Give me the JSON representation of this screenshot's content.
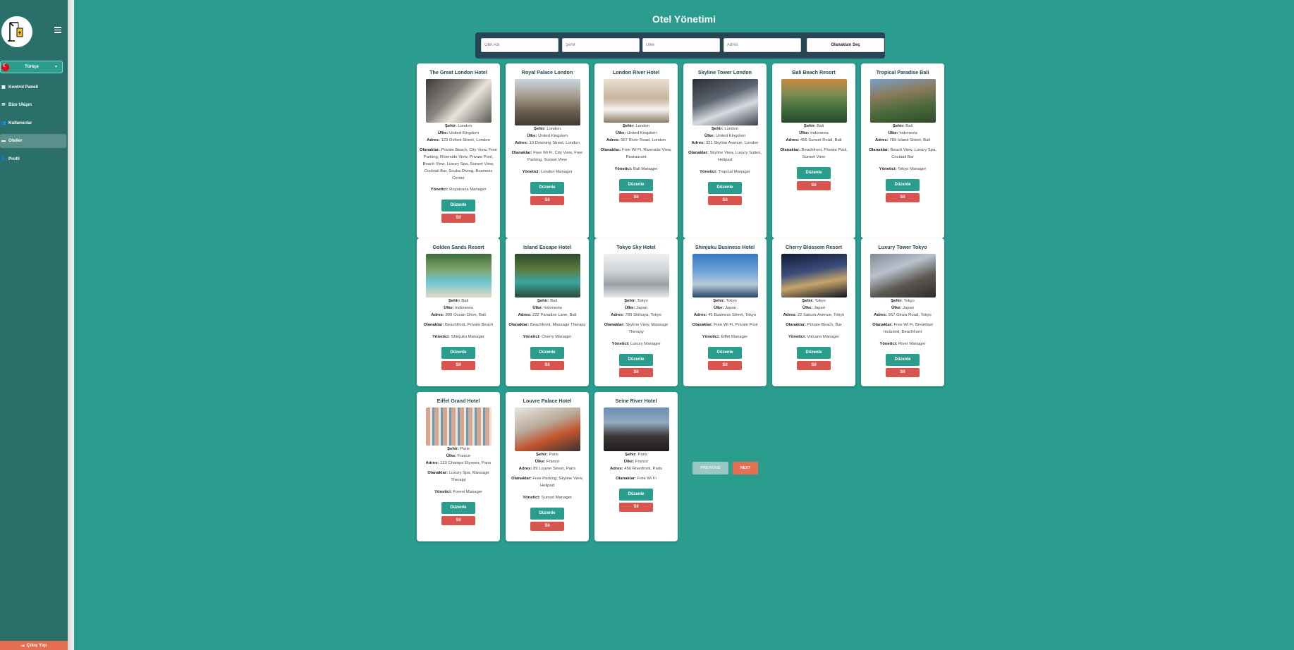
{
  "sidebar": {
    "language": "Türkçe",
    "items": [
      {
        "label": "Kontrol Paneli",
        "icon": "grid-icon",
        "active": false
      },
      {
        "label": "Bize Ulaşın",
        "icon": "envelope-icon",
        "active": false
      },
      {
        "label": "Kullanıcılar",
        "icon": "users-icon",
        "active": false
      },
      {
        "label": "Oteller",
        "icon": "bed-icon",
        "active": true
      },
      {
        "label": "Profil",
        "icon": "user-icon",
        "active": false
      }
    ],
    "logout": "Çıkış Yap"
  },
  "main": {
    "title": "Otel Yönetimi",
    "search": {
      "hotel_placeholder": "Otel Adı",
      "city_placeholder": "Şehir",
      "country_placeholder": "Ülke",
      "address_placeholder": "Adres",
      "amenities_button": "Olanakları Seç"
    },
    "labels": {
      "city": "Şehir:",
      "country": "Ülke:",
      "address": "Adres:",
      "amenities": "Olanaklar:",
      "manager": "Yönetici:",
      "edit": "Düzenle",
      "delete": "Sil"
    },
    "hotels": [
      {
        "name": "The Great London Hotel",
        "city": "London",
        "country": "United Kingdom",
        "address": "123 Oxford Street, London",
        "amenities": "Private Beach, City View, Free Parking, Riverside View, Private Pool, Beach View, Luxury Spa, Sunset View, Cocktail Bar, Scuba Diving, Business Center",
        "manager": "Royalzaza Manager"
      },
      {
        "name": "Royal Palace London",
        "city": "London",
        "country": "United Kingdom",
        "address": "10 Downing Street, London",
        "amenities": "Free Wi Fi, City View, Free Parking, Sunset View",
        "manager": "London Manager"
      },
      {
        "name": "London River Hotel",
        "city": "London",
        "country": "United Kingdom",
        "address": "567 River Road, London",
        "amenities": "Free Wi Fi, Riverside View, Restaurant",
        "manager": "Bali Manager"
      },
      {
        "name": "Skyline Tower London",
        "city": "London",
        "country": "United Kingdom",
        "address": "321 Skyline Avenue, London",
        "amenities": "Skyline View, Luxury Suites, Helipad",
        "manager": "Tropical Manager"
      },
      {
        "name": "Bali Beach Resort",
        "city": "Bali",
        "country": "Indonesia",
        "address": "456 Sunset Road, Bali",
        "amenities": "Beachfront, Private Pool, Sunset View",
        "manager": ""
      },
      {
        "name": "Tropical Paradise Bali",
        "city": "Bali",
        "country": "Indonesia",
        "address": "789 Island Street, Bali",
        "amenities": "Beach View, Luxury Spa, Cocktail Bar",
        "manager": "Tokyo Manager"
      },
      {
        "name": "Golden Sands Resort",
        "city": "Bali",
        "country": "Indonesia",
        "address": "999 Ocean Drive, Bali",
        "amenities": "Beachfront, Private Beach",
        "manager": "Shinjuku Manager"
      },
      {
        "name": "Island Escape Hotel",
        "city": "Bali",
        "country": "Indonesia",
        "address": "222 Paradise Lane, Bali",
        "amenities": "Beachfront, Massage Therapy",
        "manager": "Cherry Manager"
      },
      {
        "name": "Tokyo Sky Hotel",
        "city": "Tokyo",
        "country": "Japan",
        "address": "789 Shibuya, Tokyo",
        "amenities": "Skyline View, Massage Therapy",
        "manager": "Luxury Manager"
      },
      {
        "name": "Shinjuku Business Hotel",
        "city": "Tokyo",
        "country": "Japan",
        "address": "45 Business Street, Tokyo",
        "amenities": "Free Wi Fi, Private Pool",
        "manager": "Eiffel Manager"
      },
      {
        "name": "Cherry Blossom Resort",
        "city": "Tokyo",
        "country": "Japan",
        "address": "22 Sakura Avenue, Tokyo",
        "amenities": "Private Beach, Bar",
        "manager": "Volcano Manager"
      },
      {
        "name": "Luxury Tower Tokyo",
        "city": "Tokyo",
        "country": "Japan",
        "address": "567 Ginza Road, Tokyo",
        "amenities": "Free Wi Fi, Breakfast Included, Beachfront",
        "manager": "River Manager"
      },
      {
        "name": "Eiffel Grand Hotel",
        "city": "Paris",
        "country": "France",
        "address": "123 Champs Elysees, Paris",
        "amenities": "Luxury Spa, Massage Therapy",
        "manager": "Forest Manager"
      },
      {
        "name": "Louvre Palace Hotel",
        "city": "Paris",
        "country": "France",
        "address": "89 Louvre Street, Paris",
        "amenities": "Free Parking, Skyline View, Helipad",
        "manager": "Sunset Manager"
      },
      {
        "name": "Seine River Hotel",
        "city": "Paris",
        "country": "France",
        "address": "456 Riverfront, Paris",
        "amenities": "Free Wi Fi",
        "manager": ""
      }
    ],
    "pagination": {
      "previous": "PREVIOUS",
      "next": "NEXT"
    }
  }
}
